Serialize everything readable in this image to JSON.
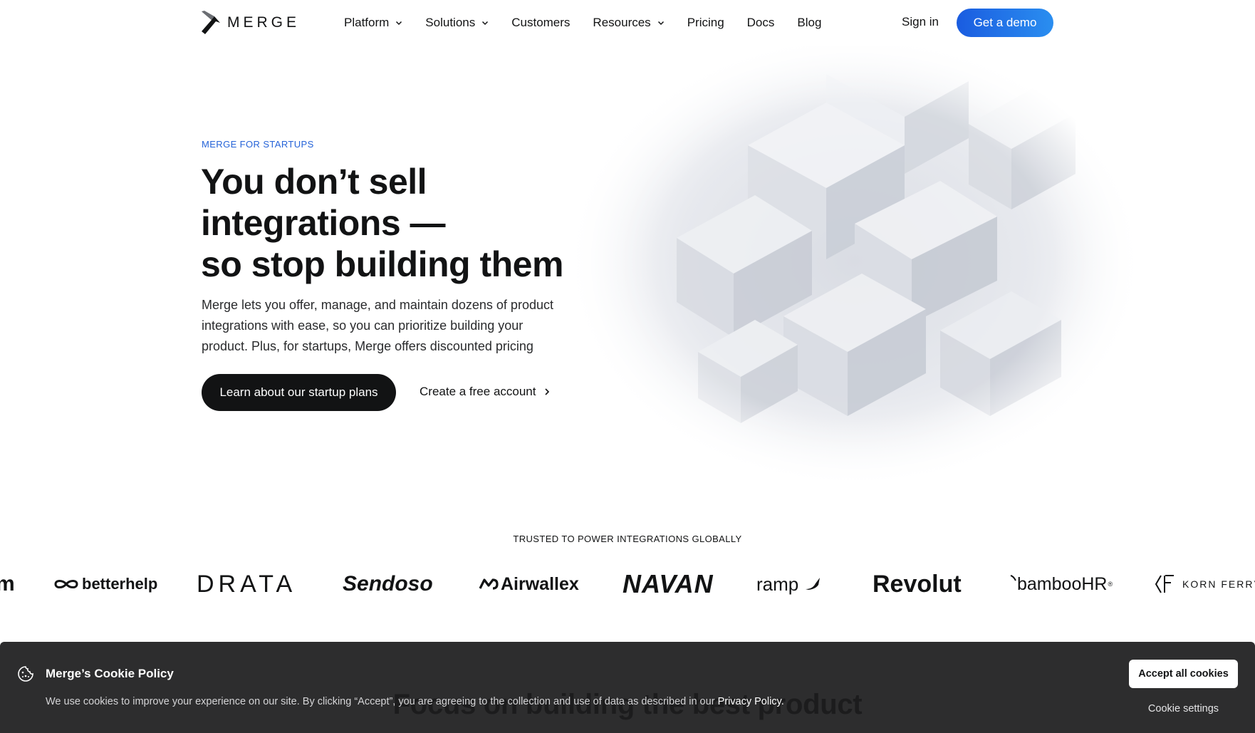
{
  "nav": {
    "logo_text": "MERGE",
    "links": [
      {
        "label": "Platform",
        "dropdown": true
      },
      {
        "label": "Solutions",
        "dropdown": true
      },
      {
        "label": "Customers",
        "dropdown": false
      },
      {
        "label": "Resources",
        "dropdown": true
      },
      {
        "label": "Pricing",
        "dropdown": false
      },
      {
        "label": "Docs",
        "dropdown": false
      },
      {
        "label": "Blog",
        "dropdown": false
      }
    ],
    "sign_in": "Sign in",
    "demo": "Get a demo"
  },
  "hero": {
    "eyebrow": "MERGE FOR STARTUPS",
    "headline": [
      "You don’t sell",
      "integrations —",
      "so stop building them"
    ],
    "subtext": [
      "Merge lets you offer, manage, and maintain dozens of product",
      "integrations with ease, so you can prioritize building your",
      "product. Plus, for startups, Merge offers discounted pricing"
    ],
    "primary_cta": "Learn about our startup plans",
    "secondary_cta": "Create a free account"
  },
  "trusted": {
    "label": "TRUSTED TO POWER INTEGRATIONS GLOBALLY",
    "logos": [
      "betterhelp",
      "DRATA",
      "Sendoso",
      "Airwallex",
      "NAVAN",
      "ramp",
      "Revolut",
      "bambooHR",
      "KORN FERRY"
    ]
  },
  "cookie": {
    "title": "Merge’s Cookie Policy",
    "text": "We use cookies to improve your experience on our site. By clicking “Accept”, you are agreeing to the collection and use of data as described in our ",
    "link": "Privacy Policy.",
    "accept": "Accept all cookies",
    "settings": "Cookie settings",
    "behind_heading": "Focus on building the best product"
  },
  "colors": {
    "accent": "#1a5ce0",
    "dark": "#121314",
    "banner": "#2d2d2e"
  }
}
